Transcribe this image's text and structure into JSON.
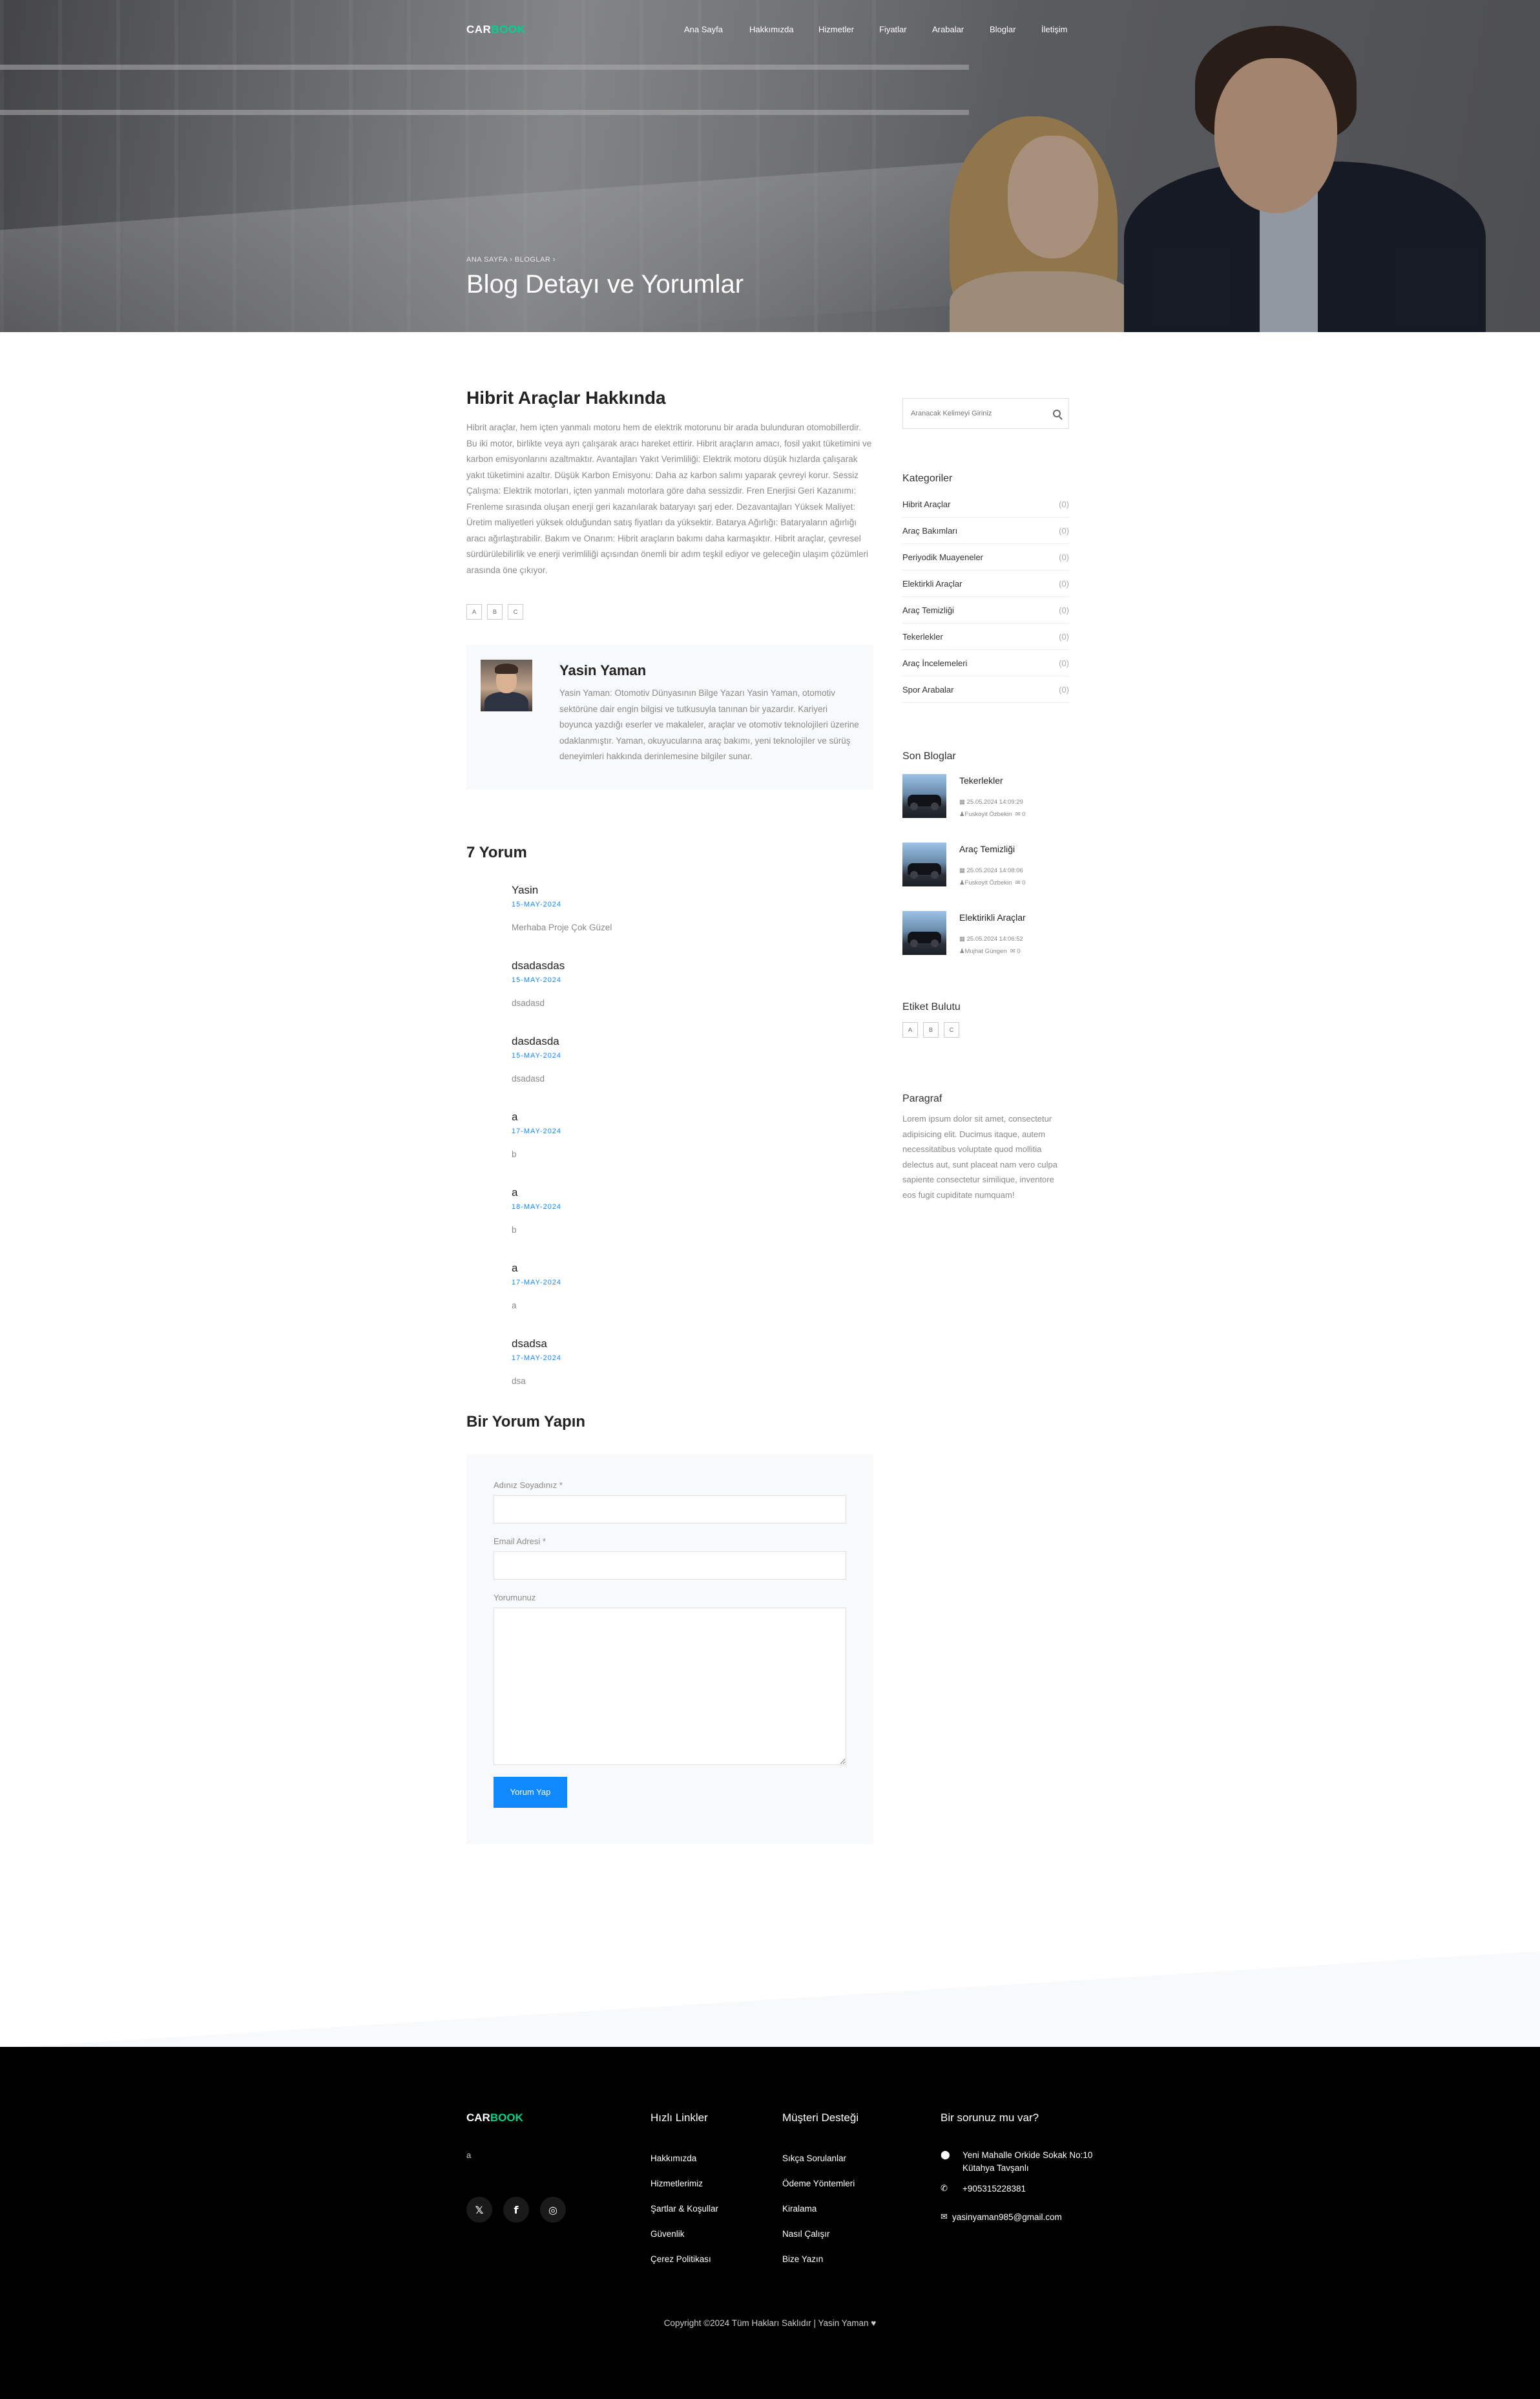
{
  "brand": {
    "part1": "CAR",
    "part2": "BOOK",
    "accent_color": "#01d28e"
  },
  "nav": {
    "items": [
      "Ana Sayfa",
      "Hakkımızda",
      "Hizmetler",
      "Fiyatlar",
      "Arabalar",
      "Bloglar",
      "İletişim"
    ]
  },
  "hero": {
    "breadcrumb": "ANA SAYFA  ›  BLOGLAR ›",
    "title": "Blog Detayı ve Yorumlar"
  },
  "post": {
    "title": "Hibrit Araçlar Hakkında",
    "body": "Hibrit araçlar, hem içten yanmalı motoru hem de elektrik motorunu bir arada bulunduran otomobillerdir. Bu iki motor, birlikte veya ayrı çalışarak aracı hareket ettirir. Hibrit araçların amacı, fosil yakıt tüketimini ve karbon emisyonlarını azaltmaktır. Avantajları Yakıt Verimliliği: Elektrik motoru düşük hızlarda çalışarak yakıt tüketimini azaltır. Düşük Karbon Emisyonu: Daha az karbon salımı yaparak çevreyi korur. Sessiz Çalışma: Elektrik motorları, içten yanmalı motorlara göre daha sessizdir. Fren Enerjisi Geri Kazanımı: Frenleme sırasında oluşan enerji geri kazanılarak bataryayı şarj eder. Dezavantajları Yüksek Maliyet: Üretim maliyetleri yüksek olduğundan satış fiyatları da yüksektir. Batarya Ağırlığı: Bataryaların ağırlığı aracı ağırlaştırabilir. Bakım ve Onarım: Hibrit araçların bakımı daha karmaşıktır. Hibrit araçlar, çevresel sürdürülebilirlik ve enerji verimliliği açısından önemli bir adım teşkil ediyor ve geleceğin ulaşım çözümleri arasında öne çıkıyor.",
    "tags": [
      "A",
      "B",
      "C"
    ]
  },
  "author": {
    "name": "Yasin Yaman",
    "bio": "Yasin Yaman: Otomotiv Dünyasının Bilge Yazarı Yasin Yaman, otomotiv sektörüne dair engin bilgisi ve tutkusuyla tanınan bir yazardır. Kariyeri boyunca yazdığı eserler ve makaleler, araçlar ve otomotiv teknolojileri üzerine odaklanmıştır. Yaman, okuyucularına araç bakımı, yeni teknolojiler ve sürüş deneyimleri hakkında derinlemesine bilgiler sunar."
  },
  "comments": {
    "title": "7 Yorum",
    "items": [
      {
        "name": "Yasin",
        "date": "15-MAY-2024",
        "text": "Merhaba Proje Çok Güzel"
      },
      {
        "name": "dsadasdas",
        "date": "15-MAY-2024",
        "text": "dsadasd"
      },
      {
        "name": "dasdasda",
        "date": "15-MAY-2024",
        "text": "dsadasd"
      },
      {
        "name": "a",
        "date": "17-MAY-2024",
        "text": "b"
      },
      {
        "name": "a",
        "date": "18-MAY-2024",
        "text": "b"
      },
      {
        "name": "a",
        "date": "17-MAY-2024",
        "text": "a"
      },
      {
        "name": "dsadsa",
        "date": "17-MAY-2024",
        "text": "dsa"
      }
    ]
  },
  "form": {
    "title": "Bir Yorum Yapın",
    "name_label": "Adınız Soyadınız *",
    "email_label": "Email Adresi *",
    "comment_label": "Yorumunuz",
    "submit_label": "Yorum Yap"
  },
  "sidebar": {
    "search_placeholder": "Aranacak Kelimeyi Giriniz",
    "categories_title": "Kategoriler",
    "categories": [
      {
        "label": "Hibrit Araçlar",
        "count": "(0)"
      },
      {
        "label": "Araç Bakımları",
        "count": "(0)"
      },
      {
        "label": "Periyodik Muayeneler",
        "count": "(0)"
      },
      {
        "label": "Elektirkli Araçlar",
        "count": "(0)"
      },
      {
        "label": "Araç Temizliği",
        "count": "(0)"
      },
      {
        "label": "Tekerlekler",
        "count": "(0)"
      },
      {
        "label": "Araç İncelemeleri",
        "count": "(0)"
      },
      {
        "label": "Spor Arabalar",
        "count": "(0)"
      }
    ],
    "recent_title": "Son Bloglar",
    "recent": [
      {
        "title": "Tekerlekler",
        "date": "25.05.2024 14:09:29",
        "author": "Fuskoyit Özbekin",
        "comments": "0"
      },
      {
        "title": "Araç Temizliği",
        "date": "25.05.2024 14:08:06",
        "author": "Fuskoyit Özbekin",
        "comments": "0"
      },
      {
        "title": "Elektirikli Araçlar",
        "date": "25.05.2024 14:06:52",
        "author": "Mujhat Güngen",
        "comments": "0"
      }
    ],
    "tag_cloud_title": "Etiket Bulutu",
    "tag_cloud": [
      "A",
      "B",
      "C"
    ],
    "paragraph_title": "Paragraf",
    "paragraph": "Lorem ipsum dolor sit amet, consectetur adipisicing elit. Ducimus itaque, autem necessitatibus voluptate quod mollitia delectus aut, sunt placeat nam vero culpa sapiente consectetur similique, inventore eos fugit cupiditate numquam!"
  },
  "footer": {
    "about": "a",
    "social_icons": [
      "twitter-icon",
      "facebook-icon",
      "instagram-icon"
    ],
    "quick_title": "Hızlı Linkler",
    "quick_links": [
      "Hakkımızda",
      "Hizmetlerimiz",
      "Şartlar & Koşullar",
      "Güvenlik",
      "Çerez Politikası"
    ],
    "support_title": "Müşteri Desteği",
    "support_links": [
      "Sıkça Sorulanlar",
      "Ödeme Yöntemleri",
      "Kiralama",
      "Nasıl Çalışır",
      "Bize Yazın"
    ],
    "contact_title": "Bir sorunuz mu var?",
    "address": "Yeni Mahalle Orkide Sokak No:10 Kütahya Tavşanlı",
    "phone": "+905315228381",
    "email": "yasinyaman985@gmail.com",
    "copyright": "Copyright ©2024 Tüm Hakları Saklıdır | Yasin Yaman ♥"
  }
}
